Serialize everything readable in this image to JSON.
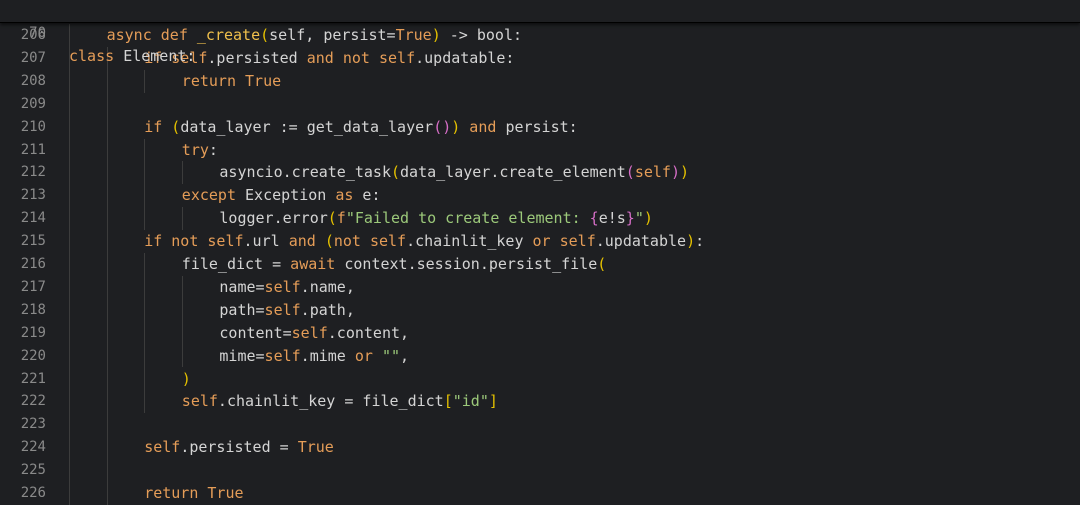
{
  "sticky": {
    "line_number": "70",
    "keyword": "class",
    "name": "Element:"
  },
  "lines": [
    {
      "n": "206",
      "indent": 1,
      "tokens": [
        {
          "t": "async ",
          "c": "k"
        },
        {
          "t": "def ",
          "c": "k"
        },
        {
          "t": "_create",
          "c": "fn"
        },
        {
          "t": "(",
          "c": "p1"
        },
        {
          "t": "self, persist=",
          "c": "dim"
        },
        {
          "t": "True",
          "c": "k"
        },
        {
          "t": ")",
          "c": "p1"
        },
        {
          "t": " -> bool:",
          "c": "dim"
        }
      ]
    },
    {
      "n": "207",
      "indent": 2,
      "tokens": [
        {
          "t": "if ",
          "c": "k"
        },
        {
          "t": "self",
          "c": "self"
        },
        {
          "t": ".persisted ",
          "c": "dim"
        },
        {
          "t": "and not ",
          "c": "k"
        },
        {
          "t": "self",
          "c": "self"
        },
        {
          "t": ".updatable:",
          "c": "dim"
        }
      ]
    },
    {
      "n": "208",
      "indent": 3,
      "tokens": [
        {
          "t": "return ",
          "c": "k"
        },
        {
          "t": "True",
          "c": "k"
        }
      ]
    },
    {
      "n": "209",
      "indent": 0,
      "tokens": []
    },
    {
      "n": "210",
      "indent": 2,
      "tokens": [
        {
          "t": "if ",
          "c": "k"
        },
        {
          "t": "(",
          "c": "p1"
        },
        {
          "t": "data_layer := get_data_layer",
          "c": "dim"
        },
        {
          "t": "(",
          "c": "p2"
        },
        {
          "t": ")",
          "c": "p2"
        },
        {
          "t": ")",
          "c": "p1"
        },
        {
          "t": " and ",
          "c": "k"
        },
        {
          "t": "persist:",
          "c": "dim"
        }
      ]
    },
    {
      "n": "211",
      "indent": 3,
      "tokens": [
        {
          "t": "try",
          "c": "k"
        },
        {
          "t": ":",
          "c": "dim"
        }
      ]
    },
    {
      "n": "212",
      "indent": 4,
      "tokens": [
        {
          "t": "asyncio.create_task",
          "c": "dim"
        },
        {
          "t": "(",
          "c": "p1"
        },
        {
          "t": "data_layer.create_element",
          "c": "dim"
        },
        {
          "t": "(",
          "c": "p2"
        },
        {
          "t": "self",
          "c": "self"
        },
        {
          "t": ")",
          "c": "p2"
        },
        {
          "t": ")",
          "c": "p1"
        }
      ]
    },
    {
      "n": "213",
      "indent": 3,
      "tokens": [
        {
          "t": "except ",
          "c": "k"
        },
        {
          "t": "Exception ",
          "c": "dim"
        },
        {
          "t": "as ",
          "c": "k"
        },
        {
          "t": "e:",
          "c": "dim"
        }
      ]
    },
    {
      "n": "214",
      "indent": 4,
      "tokens": [
        {
          "t": "logger.error",
          "c": "dim"
        },
        {
          "t": "(",
          "c": "p1"
        },
        {
          "t": "f",
          "c": "k"
        },
        {
          "t": "\"Failed to create element: ",
          "c": "str"
        },
        {
          "t": "{",
          "c": "brace"
        },
        {
          "t": "e!s",
          "c": "dim"
        },
        {
          "t": "}",
          "c": "brace"
        },
        {
          "t": "\"",
          "c": "str"
        },
        {
          "t": ")",
          "c": "p1"
        }
      ]
    },
    {
      "n": "215",
      "indent": 2,
      "tokens": [
        {
          "t": "if not ",
          "c": "k"
        },
        {
          "t": "self",
          "c": "self"
        },
        {
          "t": ".url ",
          "c": "dim"
        },
        {
          "t": "and ",
          "c": "k"
        },
        {
          "t": "(",
          "c": "p1"
        },
        {
          "t": "not ",
          "c": "k"
        },
        {
          "t": "self",
          "c": "self"
        },
        {
          "t": ".chainlit_key ",
          "c": "dim"
        },
        {
          "t": "or ",
          "c": "k"
        },
        {
          "t": "self",
          "c": "self"
        },
        {
          "t": ".updatable",
          "c": "dim"
        },
        {
          "t": ")",
          "c": "p1"
        },
        {
          "t": ":",
          "c": "dim"
        }
      ]
    },
    {
      "n": "216",
      "indent": 3,
      "tokens": [
        {
          "t": "file_dict = ",
          "c": "dim"
        },
        {
          "t": "await ",
          "c": "k"
        },
        {
          "t": "context.session.persist_file",
          "c": "dim"
        },
        {
          "t": "(",
          "c": "p1"
        }
      ]
    },
    {
      "n": "217",
      "indent": 4,
      "tokens": [
        {
          "t": "name=",
          "c": "dim"
        },
        {
          "t": "self",
          "c": "self"
        },
        {
          "t": ".name,",
          "c": "dim"
        }
      ]
    },
    {
      "n": "218",
      "indent": 4,
      "tokens": [
        {
          "t": "path=",
          "c": "dim"
        },
        {
          "t": "self",
          "c": "self"
        },
        {
          "t": ".path,",
          "c": "dim"
        }
      ]
    },
    {
      "n": "219",
      "indent": 4,
      "tokens": [
        {
          "t": "content=",
          "c": "dim"
        },
        {
          "t": "self",
          "c": "self"
        },
        {
          "t": ".content,",
          "c": "dim"
        }
      ]
    },
    {
      "n": "220",
      "indent": 4,
      "tokens": [
        {
          "t": "mime=",
          "c": "dim"
        },
        {
          "t": "self",
          "c": "self"
        },
        {
          "t": ".mime ",
          "c": "dim"
        },
        {
          "t": "or ",
          "c": "k"
        },
        {
          "t": "\"\"",
          "c": "str"
        },
        {
          "t": ",",
          "c": "dim"
        }
      ]
    },
    {
      "n": "221",
      "indent": 3,
      "tokens": [
        {
          "t": ")",
          "c": "p1"
        }
      ]
    },
    {
      "n": "222",
      "indent": 3,
      "tokens": [
        {
          "t": "self",
          "c": "self"
        },
        {
          "t": ".chainlit_key = file_dict",
          "c": "dim"
        },
        {
          "t": "[",
          "c": "p1"
        },
        {
          "t": "\"id\"",
          "c": "str"
        },
        {
          "t": "]",
          "c": "p1"
        }
      ]
    },
    {
      "n": "223",
      "indent": 0,
      "tokens": []
    },
    {
      "n": "224",
      "indent": 2,
      "tokens": [
        {
          "t": "self",
          "c": "self"
        },
        {
          "t": ".persisted = ",
          "c": "dim"
        },
        {
          "t": "True",
          "c": "k"
        }
      ]
    },
    {
      "n": "225",
      "indent": 0,
      "tokens": []
    },
    {
      "n": "226",
      "indent": 2,
      "tokens": [
        {
          "t": "return ",
          "c": "k"
        },
        {
          "t": "True",
          "c": "k"
        }
      ]
    }
  ]
}
